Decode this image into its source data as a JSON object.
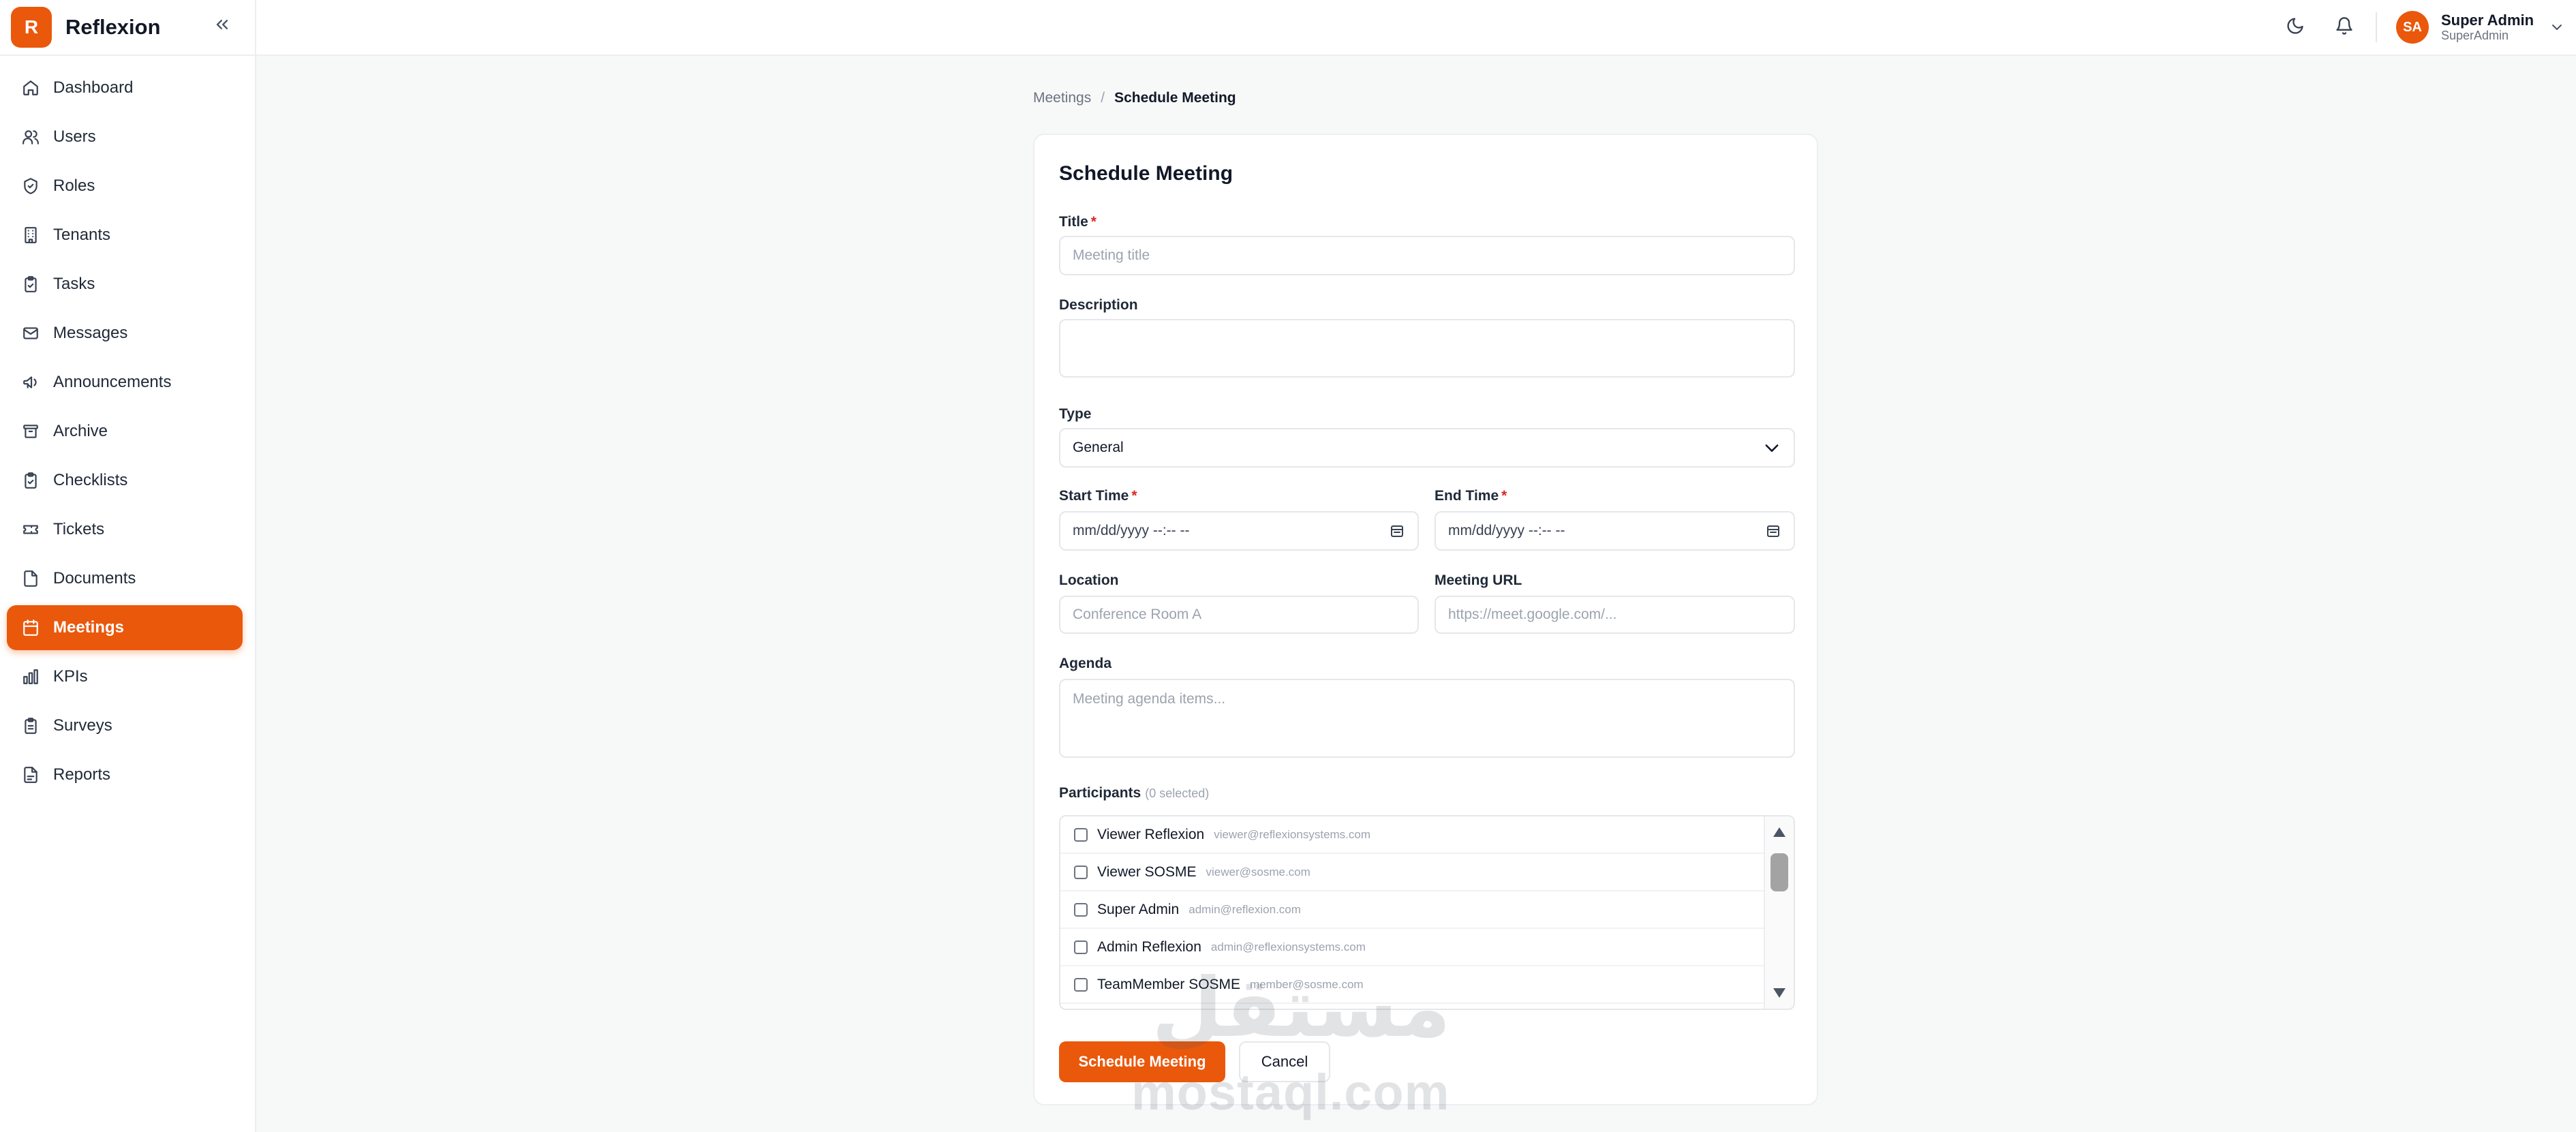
{
  "brand": {
    "logo_letter": "R",
    "name": "Reflexion",
    "color": "#ea580c"
  },
  "sidebar": {
    "items": [
      {
        "label": "Dashboard",
        "icon": "home-icon"
      },
      {
        "label": "Users",
        "icon": "users-icon"
      },
      {
        "label": "Roles",
        "icon": "shield-icon"
      },
      {
        "label": "Tenants",
        "icon": "building-icon"
      },
      {
        "label": "Tasks",
        "icon": "clipboard-check-icon"
      },
      {
        "label": "Messages",
        "icon": "mail-icon"
      },
      {
        "label": "Announcements",
        "icon": "megaphone-icon"
      },
      {
        "label": "Archive",
        "icon": "archive-icon"
      },
      {
        "label": "Checklists",
        "icon": "clipboard-list-icon"
      },
      {
        "label": "Tickets",
        "icon": "ticket-icon"
      },
      {
        "label": "Documents",
        "icon": "file-icon"
      },
      {
        "label": "Meetings",
        "icon": "calendar-icon",
        "active": true
      },
      {
        "label": "KPIs",
        "icon": "bar-chart-icon"
      },
      {
        "label": "Surveys",
        "icon": "clipboard-survey-icon"
      },
      {
        "label": "Reports",
        "icon": "file-report-icon"
      }
    ]
  },
  "topbar": {
    "user": {
      "initials": "SA",
      "name": "Super Admin",
      "role": "SuperAdmin"
    }
  },
  "breadcrumb": {
    "parent": "Meetings",
    "separator": "/",
    "current": "Schedule Meeting"
  },
  "form": {
    "title": "Schedule Meeting",
    "fields": {
      "title": {
        "label": "Title",
        "required_mark": "*",
        "placeholder": "Meeting title",
        "value": ""
      },
      "description": {
        "label": "Description",
        "placeholder": "",
        "value": ""
      },
      "type": {
        "label": "Type",
        "value": "General"
      },
      "start_time": {
        "label": "Start Time",
        "required_mark": "*",
        "value": "mm/dd/yyyy --:-- --"
      },
      "end_time": {
        "label": "End Time",
        "required_mark": "*",
        "value": "mm/dd/yyyy --:-- --"
      },
      "location": {
        "label": "Location",
        "placeholder": "Conference Room A",
        "value": ""
      },
      "meeting_url": {
        "label": "Meeting URL",
        "placeholder": "https://meet.google.com/...",
        "value": ""
      },
      "agenda": {
        "label": "Agenda",
        "placeholder": "Meeting agenda items...",
        "value": ""
      }
    },
    "participants": {
      "label": "Participants",
      "count_text": "(0 selected)",
      "items": [
        {
          "name": "Viewer Reflexion",
          "email": "viewer@reflexionsystems.com"
        },
        {
          "name": "Viewer SOSME",
          "email": "viewer@sosme.com"
        },
        {
          "name": "Super Admin",
          "email": "admin@reflexion.com"
        },
        {
          "name": "Admin Reflexion",
          "email": "admin@reflexionsystems.com"
        },
        {
          "name": "TeamMember SOSME",
          "email": "member@sosme.com"
        }
      ]
    },
    "buttons": {
      "submit": "Schedule Meeting",
      "cancel": "Cancel"
    }
  },
  "watermark": {
    "arabic": "مستقل",
    "latin": "mostaql.com"
  }
}
